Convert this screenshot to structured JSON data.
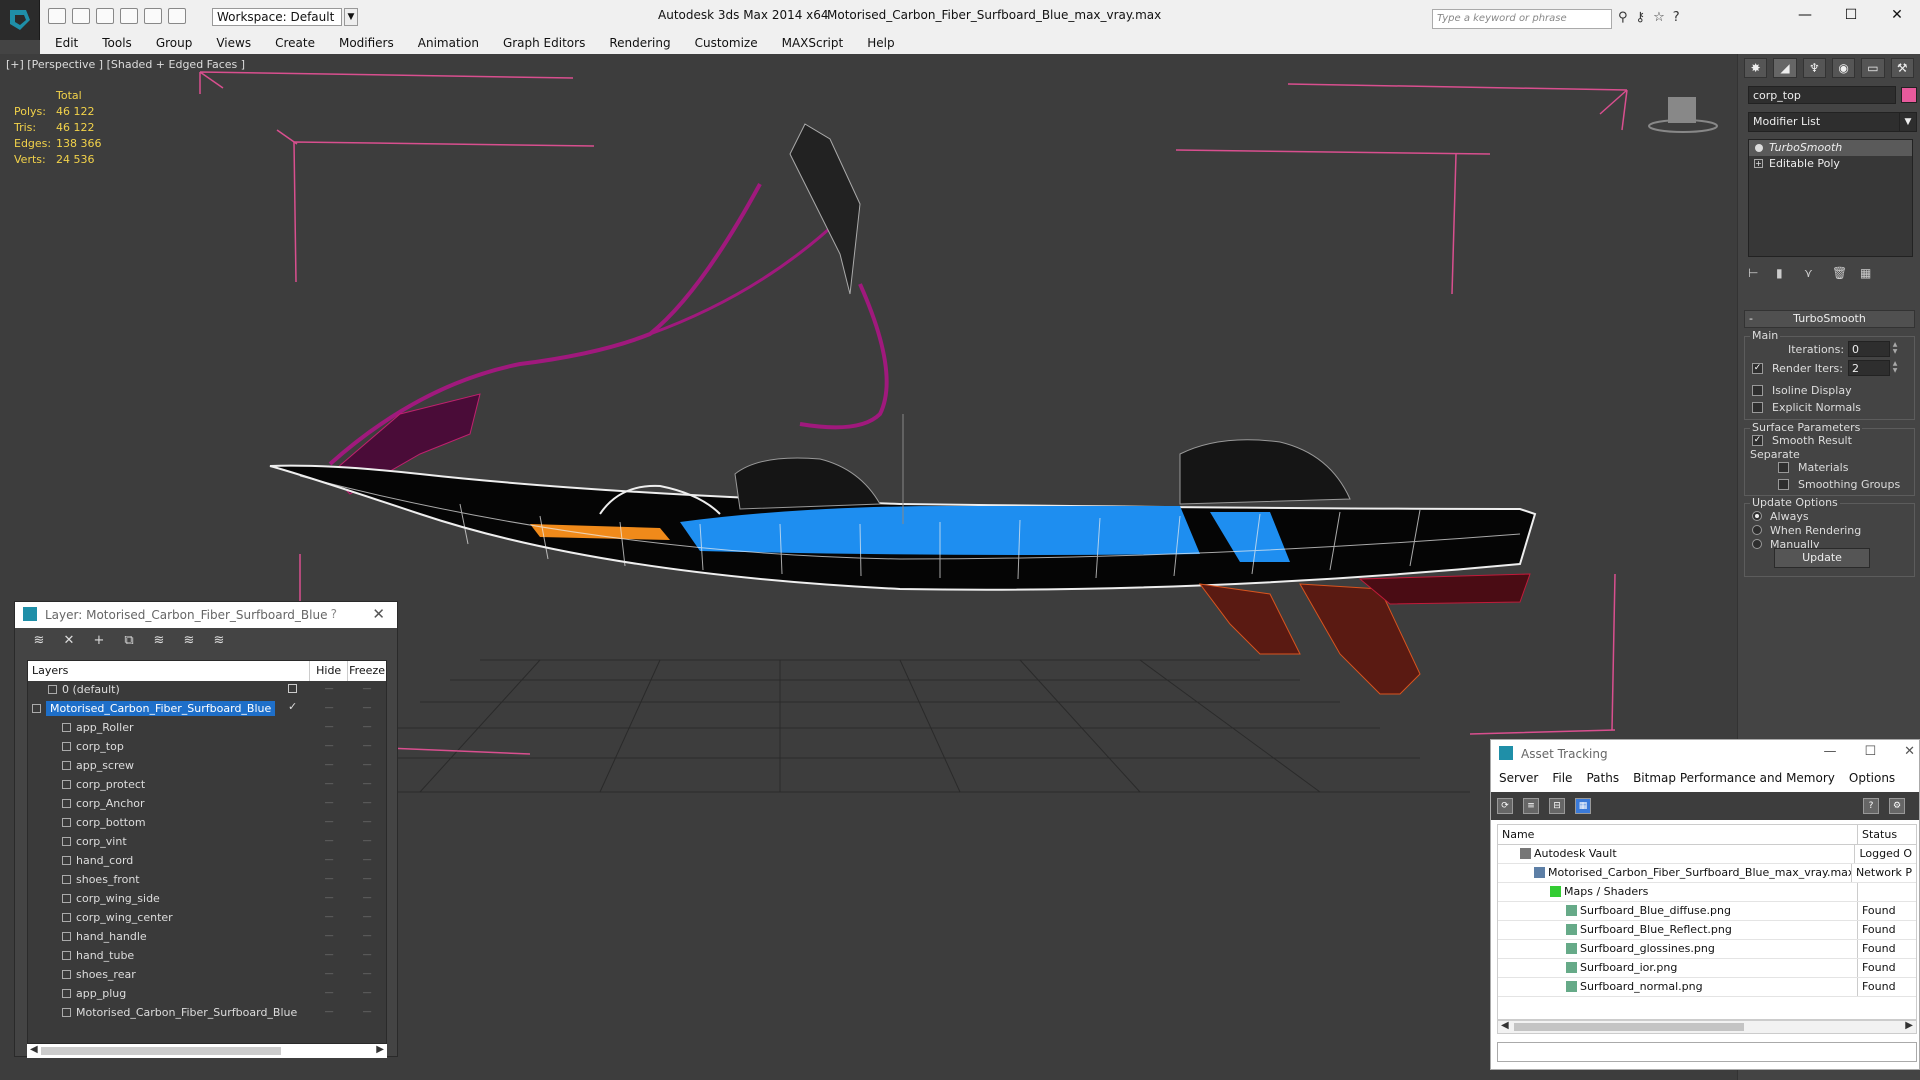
{
  "titlebar": {
    "workspace": "Workspace: Default",
    "app": "Autodesk 3ds Max  2014 x64",
    "file": "Motorised_Carbon_Fiber_Surfboard_Blue_max_vray.max",
    "search_placeholder": "Type a keyword or phrase"
  },
  "menu": [
    "Edit",
    "Tools",
    "Group",
    "Views",
    "Create",
    "Modifiers",
    "Animation",
    "Graph Editors",
    "Rendering",
    "Customize",
    "MAXScript",
    "Help"
  ],
  "viewport": {
    "label": "[+] [Perspective ] [Shaded + Edged Faces ]",
    "stats": {
      "header": "Total",
      "rows": [
        {
          "k": "Polys:",
          "v": "46 122"
        },
        {
          "k": "Tris:",
          "v": "46 122"
        },
        {
          "k": "Edges:",
          "v": "138 366"
        },
        {
          "k": "Verts:",
          "v": "24 536"
        }
      ]
    }
  },
  "command_panel": {
    "object_name": "corp_top",
    "object_color": "#e85a9c",
    "modifier_list": "Modifier List",
    "stack": [
      "TurboSmooth",
      "Editable Poly"
    ],
    "rollout": "TurboSmooth",
    "main_label": "Main",
    "iterations_label": "Iterations:",
    "iterations": "0",
    "render_iters_label": "Render Iters:",
    "render_iters": "2",
    "isoline": "Isoline Display",
    "explicit": "Explicit Normals",
    "surface_params": "Surface Parameters",
    "smooth_result": "Smooth Result",
    "separate": "Separate",
    "materials": "Materials",
    "smoothing_groups": "Smoothing Groups",
    "update_options": "Update Options",
    "always": "Always",
    "when_rendering": "When Rendering",
    "manually": "Manually",
    "update": "Update"
  },
  "layer_dialog": {
    "title": "Layer: Motorised_Carbon_Fiber_Surfboard_Blue",
    "help": "?",
    "col_layers": "Layers",
    "col_hide": "Hide",
    "col_freeze": "Freeze",
    "rows": [
      "0 (default)",
      "Motorised_Carbon_Fiber_Surfboard_Blue",
      "app_Roller",
      "corp_top",
      "app_screw",
      "corp_protect",
      "corp_Anchor",
      "corp_bottom",
      "corp_vint",
      "hand_cord",
      "shoes_front",
      "corp_wing_side",
      "corp_wing_center",
      "hand_handle",
      "hand_tube",
      "shoes_rear",
      "app_plug",
      "Motorised_Carbon_Fiber_Surfboard_Blue"
    ]
  },
  "asset_dialog": {
    "title": "Asset Tracking",
    "menu": [
      "Server",
      "File",
      "Paths",
      "Bitmap Performance and Memory",
      "Options"
    ],
    "col_name": "Name",
    "col_status": "Status",
    "rows": [
      {
        "name": "Autodesk Vault",
        "status": "Logged O",
        "icon": "vault"
      },
      {
        "name": "Motorised_Carbon_Fiber_Surfboard_Blue_max_vray.max",
        "status": "Network P",
        "icon": "file"
      },
      {
        "name": "Maps / Shaders",
        "status": "",
        "icon": "map"
      },
      {
        "name": "Surfboard_Blue_diffuse.png",
        "status": "Found",
        "icon": "img"
      },
      {
        "name": "Surfboard_Blue_Reflect.png",
        "status": "Found",
        "icon": "img"
      },
      {
        "name": "Surfboard_glossines.png",
        "status": "Found",
        "icon": "img"
      },
      {
        "name": "Surfboard_ior.png",
        "status": "Found",
        "icon": "img"
      },
      {
        "name": "Surfboard_normal.png",
        "status": "Found",
        "icon": "img"
      }
    ]
  }
}
